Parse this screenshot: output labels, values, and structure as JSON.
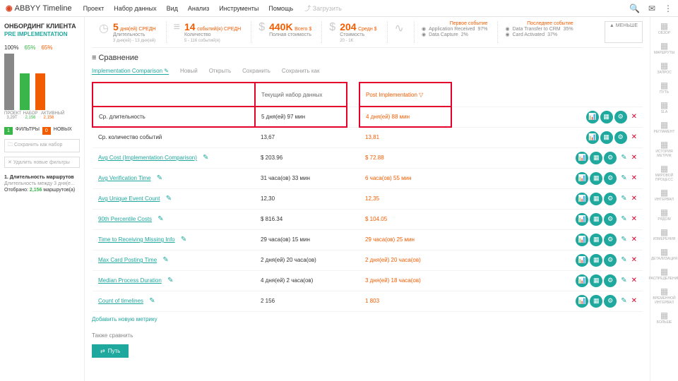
{
  "top": {
    "brand": "ABBYY",
    "product": "Timeline",
    "menu": [
      "Проект",
      "Набор данных",
      "Вид",
      "Анализ",
      "Инструменты",
      "Помощь"
    ],
    "upload": "Загрузить"
  },
  "sidebar": {
    "title": "ОНБОРДИНГ КЛИЕНТА",
    "sub": "PRE IMPLEMENTATION",
    "pct": [
      "100%",
      "65%",
      "65%"
    ],
    "cols": [
      {
        "l": "ПРОЕКТ",
        "v": "3,29T"
      },
      {
        "l": "НАБОР",
        "v": "2,156"
      },
      {
        "l": "АКТИВНЫЙ",
        "v": "2,156"
      }
    ],
    "filt": {
      "a": "1",
      "al": "ФИЛЬТРЫ",
      "b": "0",
      "bl": "НОВЫХ"
    },
    "btn1": "Сохранить как набор",
    "btn2": "Удалить новые фильтры",
    "f1": {
      "t": "1. Длительность маршрутов",
      "d": "Длительность между 3 дня(е...",
      "s1": "Отобрано:",
      "s2": "2,156",
      "s3": "маршрутов(а)"
    }
  },
  "kpi": [
    {
      "big": "5",
      "unit": "дня(ей)\nСРЕДН",
      "lbl": "Длительность",
      "det": "3 дня(ей) - 13 дня(ей)"
    },
    {
      "big": "14",
      "unit": "событий(я)\nСРЕДН",
      "lbl": "Количество",
      "det": "5 - 116 событий(я)"
    },
    {
      "big": "440K",
      "unit": "Всего\n$",
      "lbl": "Полная стоимость",
      "det": ""
    },
    {
      "big": "204",
      "unit": "Средн\n$",
      "lbl": "Стоимость",
      "det": "20 - 1K"
    }
  ],
  "evt": {
    "first": {
      "h": "Первое событие",
      "r": [
        {
          "n": "Application Received",
          "p": "97%"
        },
        {
          "n": "Data Capture",
          "p": "2%"
        }
      ]
    },
    "last": {
      "h": "Последнее событие",
      "r": [
        {
          "n": "Data Transfer to CRM",
          "p": "35%"
        },
        {
          "n": "Card Activated",
          "p": "37%"
        }
      ]
    }
  },
  "less": "▲ МЕНЬШЕ",
  "compare": {
    "title": "Сравнение",
    "tabs": [
      "Implementation Comparison",
      "Новый",
      "Открыть",
      "Сохранить",
      "Сохранить как"
    ],
    "col1": "Текущий набор данных",
    "col2": "Post Implementation"
  },
  "rows": [
    {
      "m": "Ср. длительность",
      "v1": "5 дня(ей) 97 мин",
      "v2": "4 дня(ей) 88 мин",
      "plain": true,
      "hi": true
    },
    {
      "m": "Ср. количество событий",
      "v1": "13,67",
      "v2": "13,81",
      "plain": true
    },
    {
      "m": "Avg Cost (Implementation Comparison)",
      "v1": "$ 203.96",
      "v2": "$ 72.88",
      "e": true
    },
    {
      "m": "Avg Verification Time",
      "v1": "31 часа(ов) 33 мин",
      "v2": "6 часа(ов) 55 мин",
      "e": true
    },
    {
      "m": "Avg Unique Event Count",
      "v1": "12,30",
      "v2": "12,35",
      "e": true
    },
    {
      "m": "90th Percentile Costs",
      "v1": "$ 816.34",
      "v2": "$ 104.05",
      "e": true
    },
    {
      "m": "Time to Receiving Missing Info",
      "v1": "29 часа(ов) 15 мин",
      "v2": "29 часа(ов) 25 мин",
      "e": true
    },
    {
      "m": "Max Card Posting Time",
      "v1": "2 дня(ей) 20 часа(ов)",
      "v2": "2 дня(ей) 20 часа(ов)",
      "e": true
    },
    {
      "m": "Median Process Duration",
      "v1": "4 дня(ей) 2 часа(ов)",
      "v2": "3 дня(ей) 18 часа(ов)",
      "e": true
    },
    {
      "m": "Count of timelines",
      "v1": "2 156",
      "v2": "1 803",
      "e": true
    }
  ],
  "add": "Добавить новую метрику",
  "also": "Также сравнить",
  "path": "Путь",
  "rside": [
    "ОБЗОР",
    "МАРШРУТЫ",
    "ЗАПРОС",
    "ПУТЬ",
    "SLA",
    "РЕГЛАМЕНТ",
    "ИСТОРИЯ МЕТРИК",
    "МИРОВОЙ ПРОЦЕСС",
    "ИНТЕРВАЛ",
    "РЯДОМ",
    "ИЗМЕРЕНИЯ",
    "ДЕТАЛИЗАЦИЯ",
    "РАСПРЕДЕЛЕНИЕ",
    "ВРЕМЕННОЙ ИНТЕРВАЛ",
    "БОЛЬШЕ"
  ]
}
